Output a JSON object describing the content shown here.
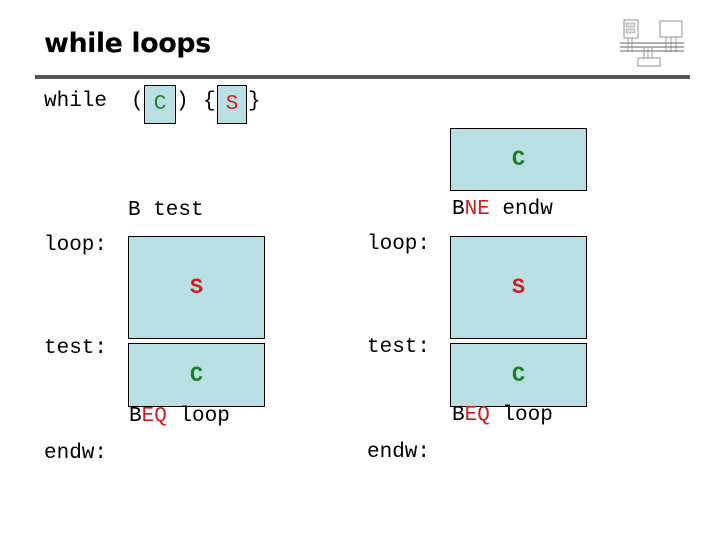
{
  "slide": {
    "title": "while loops",
    "syntax": {
      "keyword": "while",
      "open_paren": "(",
      "condition": "C",
      "close_paren": ")",
      "open_brace": "{",
      "statement": "S",
      "close_brace": "}"
    },
    "logo_icon": "system-bus-diagram-icon",
    "colors": {
      "box_fill": "#b9dfe2",
      "condition": "#1a7f2a",
      "statement": "#cc1c1c",
      "divider": "#555555"
    },
    "left_layout": {
      "branch": "B test",
      "loop_label": "loop:",
      "statement_box": "S",
      "test_label": "test:",
      "condition_box": "C",
      "cond_branch_prefix": "B",
      "cond_branch_cc": "EQ",
      "cond_branch_target": " loop",
      "end_label": "endw:"
    },
    "right_layout": {
      "condition_box_top": "C",
      "branch_prefix": "B",
      "branch_cc": "NE",
      "branch_target": " endw",
      "loop_label": "loop:",
      "statement_box": "S",
      "test_label": "test:",
      "condition_box": "C",
      "cond_branch_prefix": "B",
      "cond_branch_cc": "EQ",
      "cond_branch_target": " loop",
      "end_label": "endw:"
    }
  }
}
